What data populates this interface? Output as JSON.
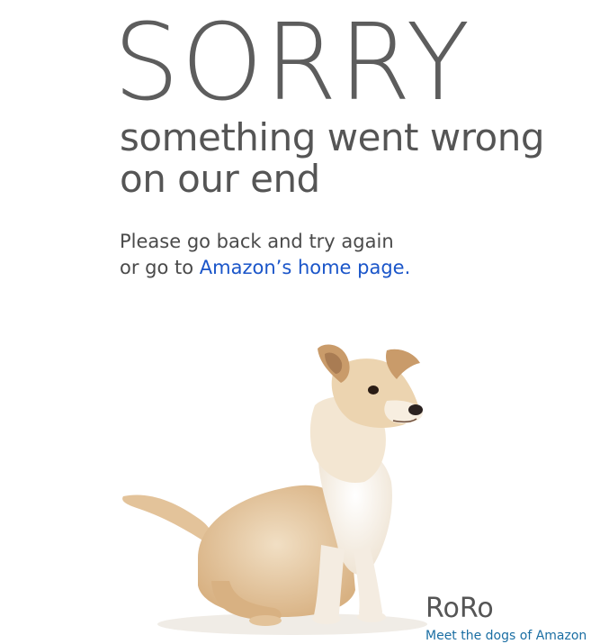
{
  "error": {
    "headline": "SORRY",
    "subtitle_line1": "something went wrong",
    "subtitle_line2": "on our end",
    "message_line1": "Please go back and try again",
    "message_line2_prefix": "or go to ",
    "home_link": "Amazon’s home page."
  },
  "dog": {
    "name": "RoRo",
    "link": "Meet the dogs of Amazon"
  },
  "colors": {
    "text": "#595959",
    "link": "#1a55c9",
    "caption_link": "#1a6ea3",
    "background": "#ffffff"
  }
}
